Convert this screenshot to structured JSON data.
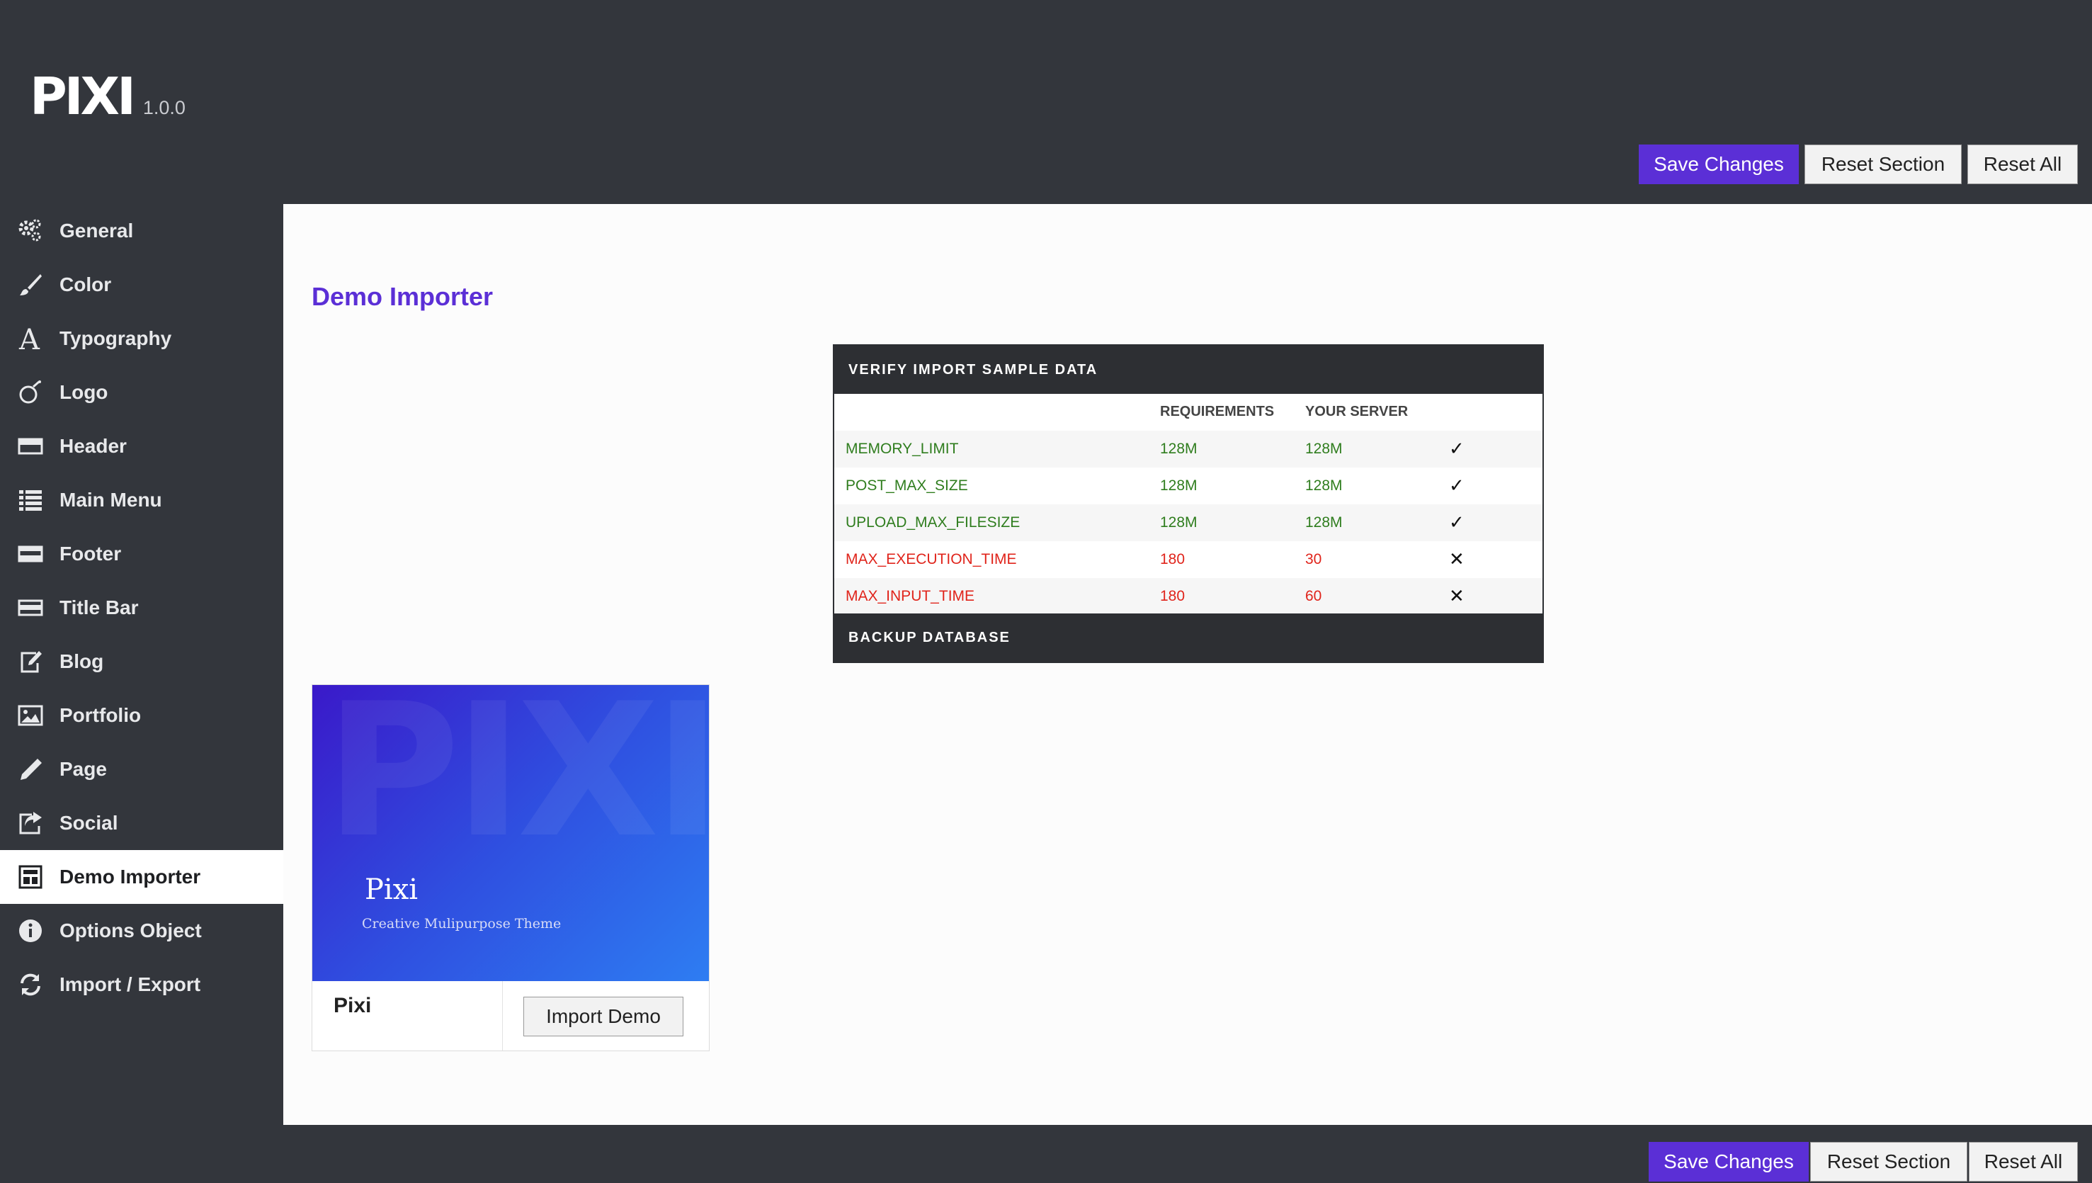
{
  "header": {
    "logo": "PIXI",
    "version": "1.0.0",
    "save_label": "Save Changes",
    "reset_section_label": "Reset Section",
    "reset_all_label": "Reset All"
  },
  "sidebar": {
    "items": [
      {
        "label": "General",
        "icon": "gears-icon"
      },
      {
        "label": "Color",
        "icon": "brush-icon"
      },
      {
        "label": "Typography",
        "icon": "font-icon"
      },
      {
        "label": "Logo",
        "icon": "logo-icon"
      },
      {
        "label": "Header",
        "icon": "header-icon"
      },
      {
        "label": "Main Menu",
        "icon": "list-icon"
      },
      {
        "label": "Footer",
        "icon": "footer-icon"
      },
      {
        "label": "Title Bar",
        "icon": "title-bar-icon"
      },
      {
        "label": "Blog",
        "icon": "edit-icon"
      },
      {
        "label": "Portfolio",
        "icon": "image-icon"
      },
      {
        "label": "Page",
        "icon": "pencil-icon"
      },
      {
        "label": "Social",
        "icon": "share-icon"
      },
      {
        "label": "Demo Importer",
        "icon": "layout-icon",
        "active": true
      },
      {
        "label": "Options Object",
        "icon": "info-icon"
      },
      {
        "label": "Import / Export",
        "icon": "refresh-icon"
      }
    ]
  },
  "main": {
    "title": "Demo Importer",
    "verify": {
      "heading": "VERIFY IMPORT SAMPLE DATA",
      "col_requirements": "REQUIREMENTS",
      "col_server": "YOUR SERVER",
      "rows": [
        {
          "name": "MEMORY_LIMIT",
          "required": "128M",
          "server": "128M",
          "status": "ok"
        },
        {
          "name": "POST_MAX_SIZE",
          "required": "128M",
          "server": "128M",
          "status": "ok"
        },
        {
          "name": "UPLOAD_MAX_FILESIZE",
          "required": "128M",
          "server": "128M",
          "status": "ok"
        },
        {
          "name": "MAX_EXECUTION_TIME",
          "required": "180",
          "server": "30",
          "status": "fail"
        },
        {
          "name": "MAX_INPUT_TIME",
          "required": "180",
          "server": "60",
          "status": "fail"
        }
      ],
      "footer": "BACKUP DATABASE"
    },
    "demo": {
      "image_bg_text": "PIXI",
      "image_title": "Pixi",
      "image_subtitle": "Creative Mulipurpose Theme",
      "name": "Pixi",
      "import_label": "Import Demo"
    }
  },
  "footer": {
    "save_label": "Save Changes",
    "reset_section_label": "Reset Section",
    "reset_all_label": "Reset All"
  },
  "colors": {
    "accent": "#5b2fd6",
    "sidebar_bg": "#33363c",
    "ok": "#2f7d1e",
    "fail": "#e0241b"
  }
}
